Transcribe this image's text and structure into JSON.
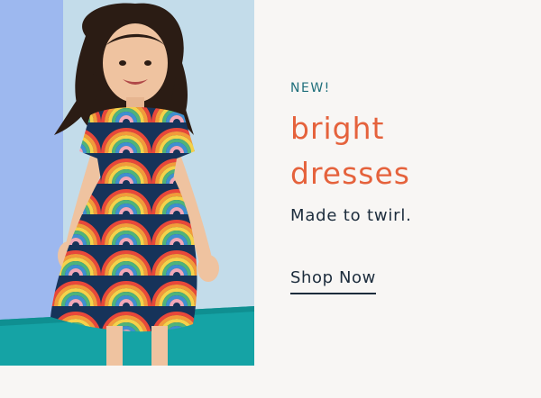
{
  "promo": {
    "eyebrow": "NEW!",
    "headline_line1": "bright",
    "headline_line2": "dresses",
    "tagline": "Made to twirl.",
    "cta_label": "Shop Now"
  },
  "colors": {
    "background": "#f8f6f4",
    "eyebrow": "#1f6f7b",
    "headline": "#e5623c",
    "body_text": "#1c2c3c"
  }
}
